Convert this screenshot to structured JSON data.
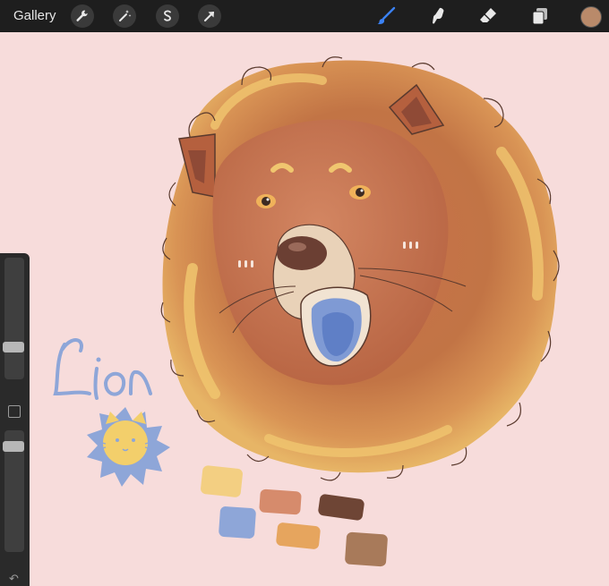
{
  "toolbar": {
    "gallery_label": "Gallery",
    "actions": [
      {
        "name": "wrench-icon"
      },
      {
        "name": "magic-wand-icon"
      },
      {
        "name": "selection-icon"
      },
      {
        "name": "transform-arrow-icon"
      }
    ],
    "tools": [
      {
        "name": "brush-icon",
        "active": true
      },
      {
        "name": "smudge-icon"
      },
      {
        "name": "eraser-icon"
      },
      {
        "name": "layers-icon"
      }
    ],
    "current_color": "#b98a6a",
    "accent": "#3b82f6"
  },
  "sidebar": {
    "brush_size_level": 0.3,
    "opacity_level": 0.85,
    "undo_icon": "undo-arrow-icon"
  },
  "artwork": {
    "handwritten_label": "Lion",
    "palette": [
      "#f3cf82",
      "#d68b6c",
      "#6e4535",
      "#8ea6d8",
      "#e6a55e",
      "#a87a5a"
    ]
  }
}
